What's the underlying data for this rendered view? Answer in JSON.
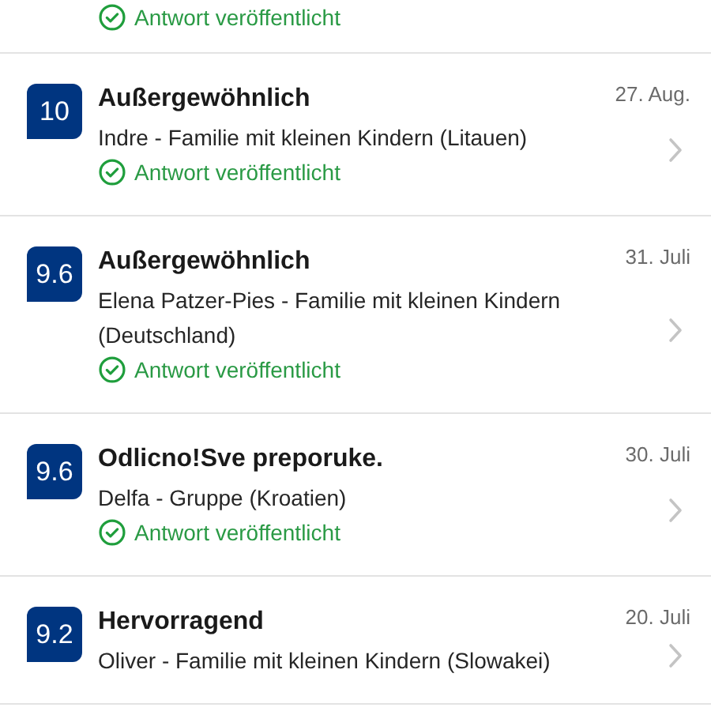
{
  "previous_review": {
    "status": "Antwort veröffentlicht"
  },
  "reviews": [
    {
      "score": "10",
      "title": "Außergewöhnlich",
      "date": "27. Aug.",
      "author": "Indre  - Familie mit kleinen Kindern (Litauen)",
      "replied": true,
      "status": "Antwort veröffentlicht"
    },
    {
      "score": "9.6",
      "title": "Außergewöhnlich",
      "date": "31. Juli",
      "author": "Elena Patzer-Pies - Familie mit kleinen Kindern (Deutschland)",
      "replied": true,
      "status": "Antwort veröffentlicht"
    },
    {
      "score": "9.6",
      "title": "Odlicno!Sve preporuke.",
      "date": "30. Juli",
      "author": "Delfa - Gruppe (Kroatien)",
      "replied": true,
      "status": "Antwort veröffentlicht"
    },
    {
      "score": "9.2",
      "title": "Hervorragend",
      "date": "20. Juli",
      "author": "Oliver - Familie mit kleinen Kindern (Slowakei)",
      "replied": false
    }
  ]
}
